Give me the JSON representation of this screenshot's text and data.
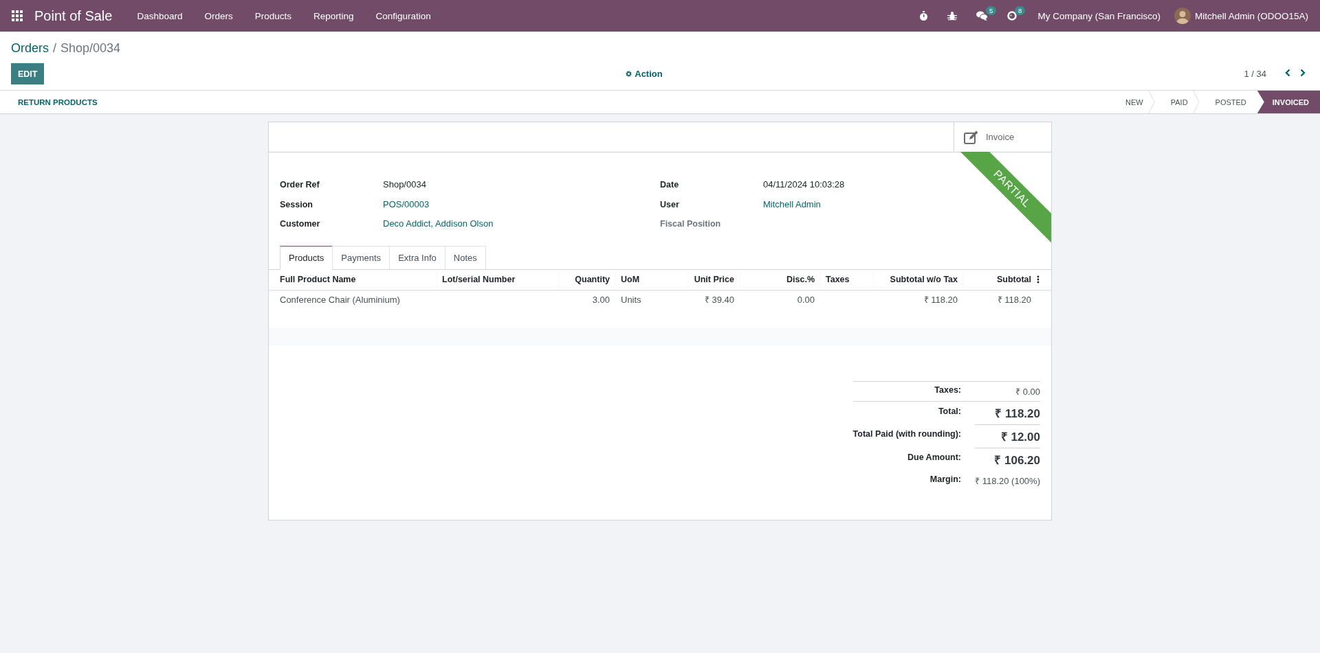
{
  "navbar": {
    "app_name": "Point of Sale",
    "menus": [
      "Dashboard",
      "Orders",
      "Products",
      "Reporting",
      "Configuration"
    ],
    "chat_count": "5",
    "activity_count": "8",
    "company": "My Company (San Francisco)",
    "user": "Mitchell Admin (ODOO15A)"
  },
  "breadcrumb": {
    "parent": "Orders",
    "separator": "/",
    "current": "Shop/0034"
  },
  "control_panel": {
    "edit_button": "EDIT",
    "action_button": "Action",
    "pager": "1 / 34"
  },
  "status_bar": {
    "button": "RETURN PRODUCTS",
    "stages": [
      {
        "label": "NEW",
        "selected": false
      },
      {
        "label": "PAID",
        "selected": false
      },
      {
        "label": "POSTED",
        "selected": false
      },
      {
        "label": "INVOICED",
        "selected": true
      }
    ]
  },
  "sheet": {
    "smart_button": "Invoice",
    "ribbon": "PARTIAL",
    "fields_left": [
      {
        "label": "Order Ref",
        "value": "Shop/0034",
        "kind": "text"
      },
      {
        "label": "Session",
        "value": "POS/00003",
        "kind": "link"
      },
      {
        "label": "Customer",
        "value": "Deco Addict, Addison Olson",
        "kind": "link"
      }
    ],
    "fields_right": [
      {
        "label": "Date",
        "value": "04/11/2024 10:03:28",
        "kind": "text"
      },
      {
        "label": "User",
        "value": "Mitchell Admin",
        "kind": "link"
      },
      {
        "label": "Fiscal Position",
        "kind": "empty"
      }
    ],
    "tabs": [
      {
        "label": "Products",
        "selected": true
      },
      {
        "label": "Payments",
        "selected": false
      },
      {
        "label": "Extra Info",
        "selected": false
      },
      {
        "label": "Notes",
        "selected": false
      }
    ],
    "table": {
      "columns": [
        "Full Product Name",
        "Lot/serial Number",
        "Quantity",
        "UoM",
        "Unit Price",
        "Disc.%",
        "Taxes",
        "Subtotal w/o Tax",
        "Subtotal"
      ],
      "rows": [
        [
          "Conference Chair (Aluminium)",
          "",
          "3.00",
          "Units",
          "₹ 39.40",
          "0.00",
          "",
          "₹ 118.20",
          "₹ 118.20"
        ]
      ]
    },
    "totals": [
      {
        "label": "Taxes:",
        "value": "₹ 0.00",
        "kind": "small"
      },
      {
        "label": "Total:",
        "value": "₹ 118.20",
        "kind": "large"
      },
      {
        "label": "Total Paid (with rounding):",
        "value": "₹ 12.00",
        "kind": "large"
      },
      {
        "label": "Due Amount:",
        "value": "₹ 106.20",
        "kind": "large"
      },
      {
        "label": "Margin:",
        "value": "₹ 118.20 (100%)",
        "kind": "small"
      }
    ]
  }
}
